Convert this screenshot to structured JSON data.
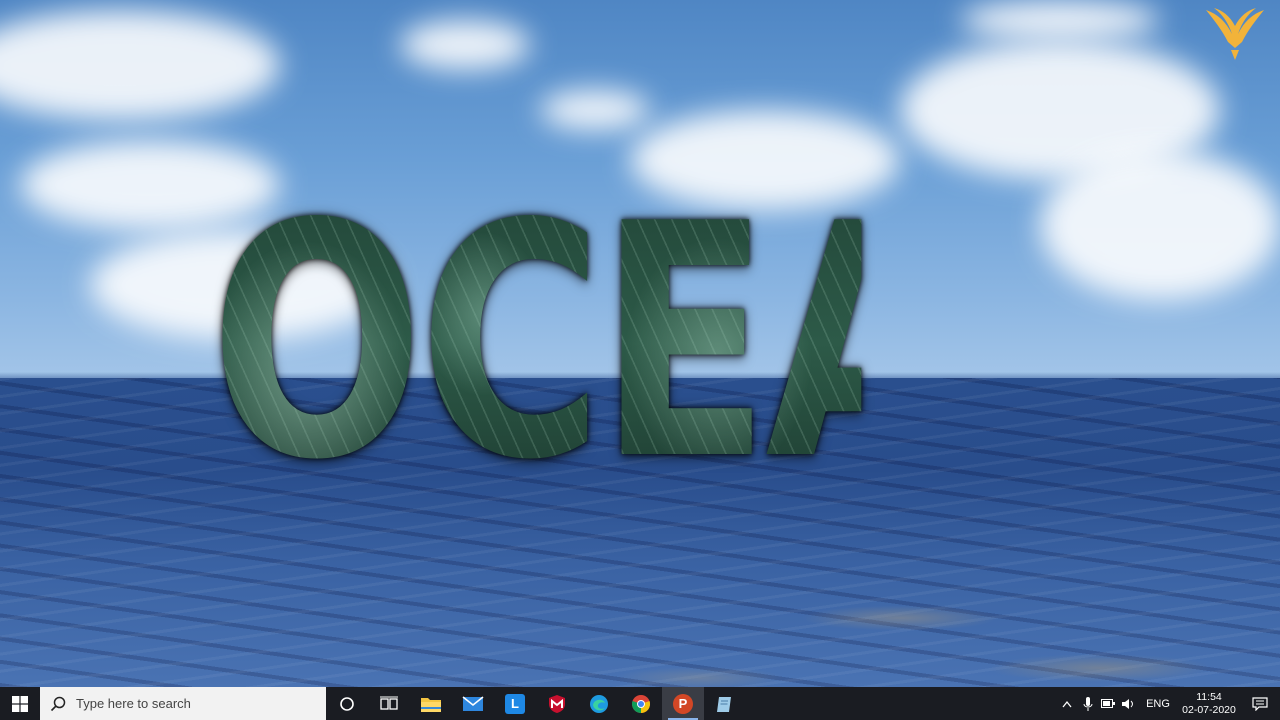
{
  "slide": {
    "title": "OCEAN",
    "logo_icon": "eagle-logo-icon",
    "colors": {
      "title_fill": "#2d5a48",
      "sky": "#6a9fd6",
      "sea": "#2a4f8e",
      "logo": "#f2b33a"
    }
  },
  "taskbar": {
    "start_icon": "windows-start-icon",
    "search_placeholder": "Type here to search",
    "cortana_icon": "cortana-circle-icon",
    "task_view_icon": "task-view-icon",
    "pinned": [
      {
        "name": "file-explorer-icon",
        "label": ""
      },
      {
        "name": "mail-icon",
        "label": ""
      },
      {
        "name": "l-app-icon",
        "label": "L"
      },
      {
        "name": "mcafee-icon",
        "label": ""
      },
      {
        "name": "edge-icon",
        "label": ""
      },
      {
        "name": "chrome-icon",
        "label": ""
      },
      {
        "name": "powerpoint-icon",
        "label": "P"
      },
      {
        "name": "notepad-icon",
        "label": ""
      }
    ],
    "tray": {
      "chevron_icon": "chevron-up-icon",
      "language": "ENG",
      "time": "11:54",
      "date": "02-07-2020",
      "notification_icon": "notification-icon"
    }
  }
}
